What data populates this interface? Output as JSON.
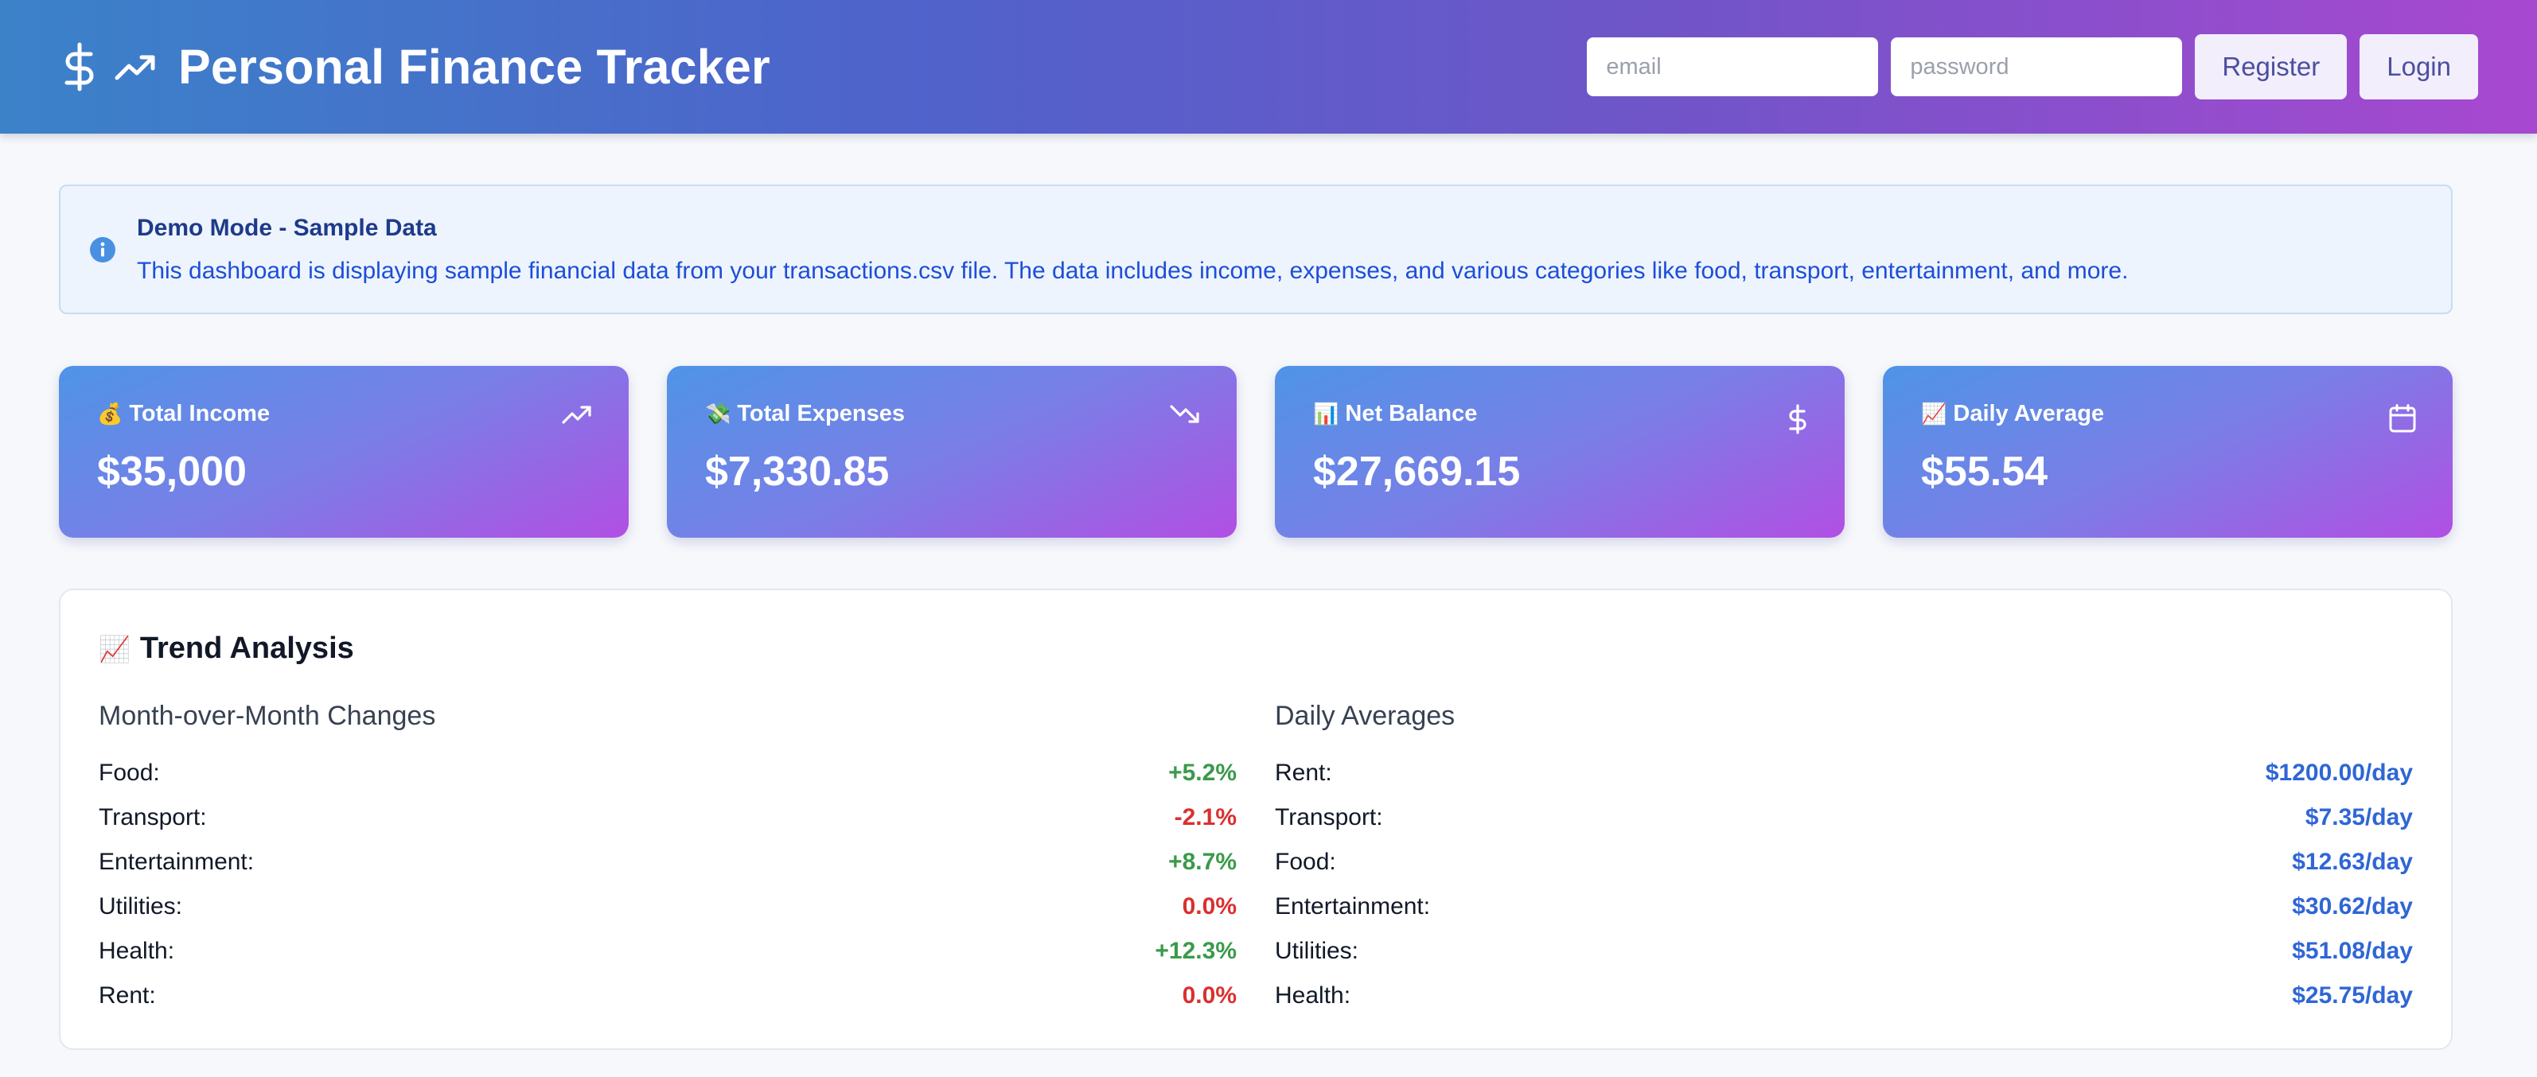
{
  "header": {
    "title": "Personal Finance Tracker",
    "email_placeholder": "email",
    "password_placeholder": "password",
    "register_label": "Register",
    "login_label": "Login"
  },
  "banner": {
    "title": "Demo Mode - Sample Data",
    "text": "This dashboard is displaying sample financial data from your transactions.csv file. The data includes income, expenses, and various categories like food, transport, entertainment, and more."
  },
  "cards": [
    {
      "emoji": "💰",
      "label": "Total Income",
      "value": "$35,000",
      "icon": "trending-up-icon"
    },
    {
      "emoji": "💸",
      "label": "Total Expenses",
      "value": "$7,330.85",
      "icon": "trending-down-icon"
    },
    {
      "emoji": "📊",
      "label": "Net Balance",
      "value": "$27,669.15",
      "icon": "dollar-icon"
    },
    {
      "emoji": "📈",
      "label": "Daily Average",
      "value": "$55.54",
      "icon": "calendar-icon"
    }
  ],
  "trend": {
    "emoji": "📈",
    "title": "Trend Analysis",
    "mom_title": "Month-over-Month Changes",
    "mom": [
      {
        "label": "Food:",
        "value": "+5.2%"
      },
      {
        "label": "Transport:",
        "value": "-2.1%"
      },
      {
        "label": "Entertainment:",
        "value": "+8.7%"
      },
      {
        "label": "Utilities:",
        "value": "0.0%"
      },
      {
        "label": "Health:",
        "value": "+12.3%"
      },
      {
        "label": "Rent:",
        "value": "0.0%"
      }
    ],
    "daily_title": "Daily Averages",
    "daily": [
      {
        "label": "Rent:",
        "value": "$1200.00/day"
      },
      {
        "label": "Transport:",
        "value": "$7.35/day"
      },
      {
        "label": "Food:",
        "value": "$12.63/day"
      },
      {
        "label": "Entertainment:",
        "value": "$30.62/day"
      },
      {
        "label": "Utilities:",
        "value": "$51.08/day"
      },
      {
        "label": "Health:",
        "value": "$25.75/day"
      }
    ]
  },
  "colors": {
    "positive": "#3a9a4a",
    "negative": "#d93030",
    "average": "#2f66d6"
  }
}
